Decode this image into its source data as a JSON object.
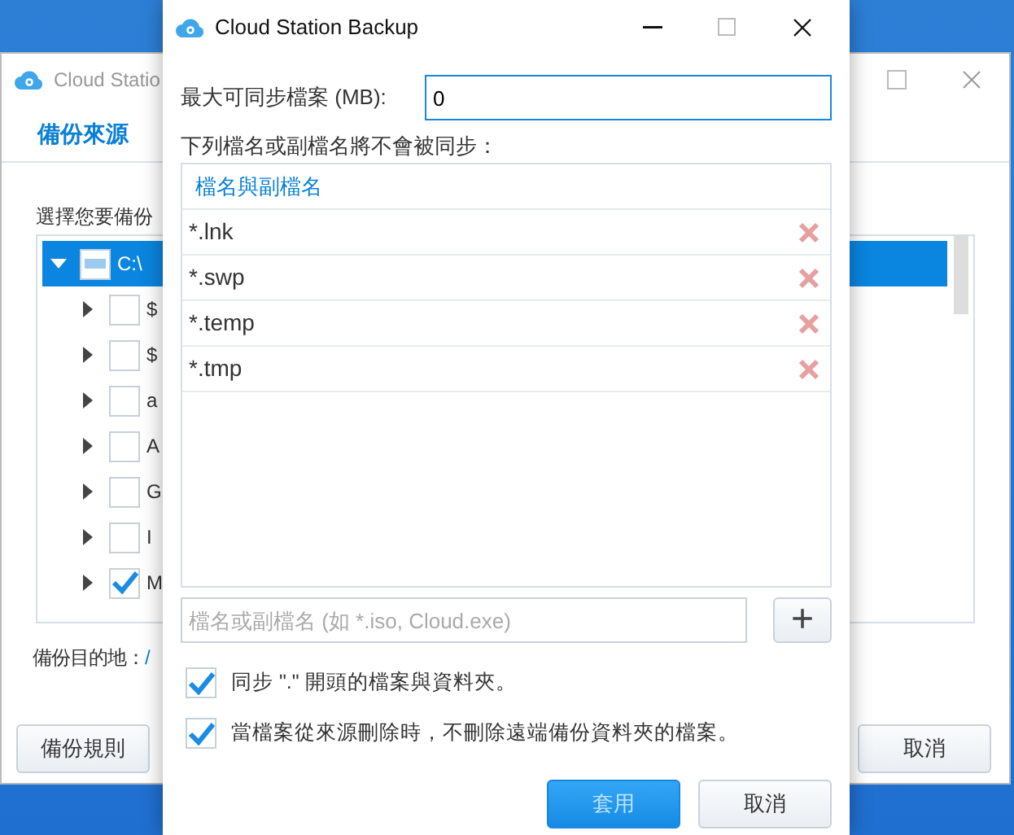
{
  "back_window": {
    "title": "Cloud Statio",
    "tab": {
      "label": "備份來源",
      "selected": true
    },
    "prompt": "選擇您要備份",
    "tree": [
      {
        "label": "C:\\",
        "expanded": true,
        "selected": true,
        "partial": true,
        "children": [
          {
            "label": "$",
            "expanded": false,
            "selected": false,
            "checked": false
          },
          {
            "label": "$",
            "expanded": false,
            "selected": false,
            "checked": false
          },
          {
            "label": "a",
            "expanded": false,
            "selected": false,
            "checked": false
          },
          {
            "label": "A",
            "expanded": false,
            "selected": false,
            "checked": false
          },
          {
            "label": "G",
            "expanded": false,
            "selected": false,
            "checked": false
          },
          {
            "label": "I",
            "expanded": false,
            "selected": false,
            "checked": false
          },
          {
            "label": "M",
            "expanded": false,
            "selected": false,
            "checked": true
          }
        ]
      }
    ],
    "destination_label": "備份目的地：",
    "destination_value": "/",
    "buttons": [
      "備份規則",
      "取消"
    ]
  },
  "dialog": {
    "title": "Cloud Station Backup",
    "max_size_label": "最大可同步檔案 (MB):",
    "max_size_value": "0",
    "exclude_label": "下列檔名或副檔名將不會被同步：",
    "table": {
      "column": "檔名與副檔名",
      "rows": [
        "*.lnk",
        "*.swp",
        "*.temp",
        "*.tmp"
      ]
    },
    "new_entry": {
      "placeholder": "檔名或副檔名 (如 *.iso, Cloud.exe)",
      "add_button": "+"
    },
    "options": [
      {
        "label": "同步 \".\" 開頭的檔案與資料夾。",
        "checked": true
      },
      {
        "label": "當檔案從來源刪除時，不刪除遠端備份資料夾的檔案。",
        "checked": true
      }
    ],
    "buttons": [
      {
        "label": "套用",
        "kind": "primary"
      },
      {
        "label": "取消",
        "kind": "secondary"
      }
    ]
  }
}
